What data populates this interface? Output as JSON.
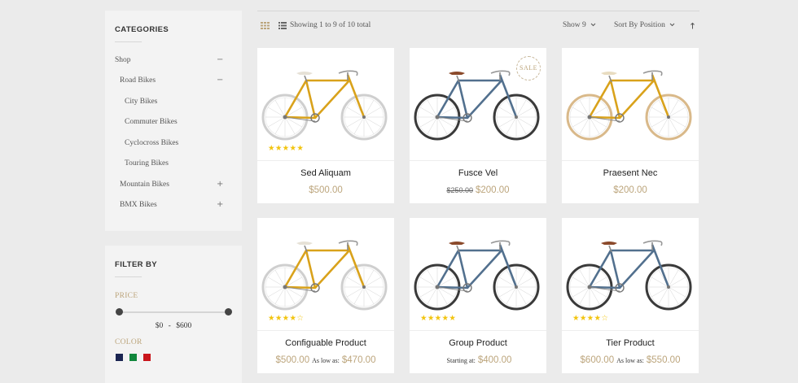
{
  "sidebar": {
    "categories_title": "CATEGORIES",
    "category_items": [
      {
        "label": "Shop",
        "toggle": "−"
      },
      {
        "label": "Road Bikes",
        "toggle": "−"
      },
      {
        "label": "City Bikes",
        "toggle": ""
      },
      {
        "label": "Commuter Bikes",
        "toggle": ""
      },
      {
        "label": "Cyclocross Bikes",
        "toggle": ""
      },
      {
        "label": "Touring Bikes",
        "toggle": ""
      },
      {
        "label": "Mountain Bikes",
        "toggle": "+"
      },
      {
        "label": "BMX Bikes",
        "toggle": "+"
      }
    ],
    "filter_title": "FILTER BY",
    "price_label": "PRICE",
    "price_min": "$0",
    "price_sep": "-",
    "price_max": "$600",
    "color_label": "COLOR",
    "swatches": [
      "#1b2552",
      "#11873c",
      "#c9161c"
    ]
  },
  "toolbar": {
    "showing_text": "Showing 1 to 9 of 10 total",
    "show_label": "Show",
    "show_value": "9",
    "sort_label": "Sort By",
    "sort_value": "Position",
    "grid_icon": "grid-icon",
    "list_icon": "list-icon",
    "sort_direction_icon": "arrow-up-icon"
  },
  "products": [
    {
      "name": "Sed Aliquam",
      "price": "$500.00",
      "old_price": "",
      "price_prefix": "",
      "price_label": "",
      "special_price": "",
      "rating": 5,
      "sale": "",
      "bike": "yellow"
    },
    {
      "name": "Fusce Vel",
      "price": "$200.00",
      "old_price": "$250.00",
      "price_prefix": "",
      "price_label": "",
      "special_price": "",
      "rating": 0,
      "sale": "SALE",
      "bike": "blue"
    },
    {
      "name": "Praesent Nec",
      "price": "$200.00",
      "old_price": "",
      "price_prefix": "",
      "price_label": "",
      "special_price": "",
      "rating": 0,
      "sale": "",
      "bike": "yellow-tan"
    },
    {
      "name": "Configuable Product",
      "price": "$500.00",
      "old_price": "",
      "price_prefix": "",
      "price_label": "As low as:",
      "special_price": "$470.00",
      "rating": 4,
      "sale": "",
      "bike": "yellow"
    },
    {
      "name": "Group Product",
      "price": "$400.00",
      "old_price": "",
      "price_prefix": "Starting at:",
      "price_label": "",
      "special_price": "",
      "rating": 5,
      "sale": "",
      "bike": "blue"
    },
    {
      "name": "Tier Product",
      "price": "$600.00",
      "old_price": "",
      "price_prefix": "",
      "price_label": "As low as:",
      "special_price": "$550.00",
      "rating": 4,
      "sale": "",
      "bike": "blue"
    }
  ],
  "colors": {
    "accent_gold": "#bca57c",
    "star": "#f2c40f",
    "bike_yellow": "#d9a21b",
    "bike_blue": "#52708e"
  }
}
